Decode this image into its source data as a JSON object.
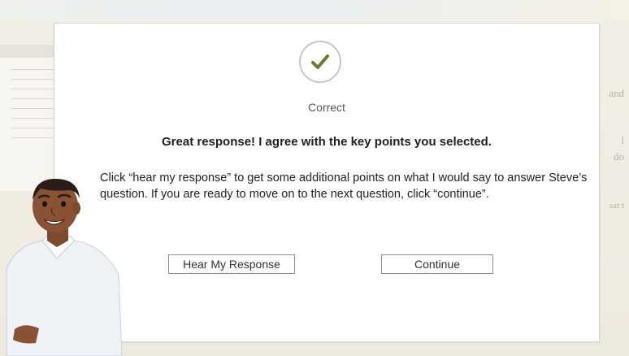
{
  "background": {
    "side_text": [
      "and",
      "l",
      "do",
      "sat t"
    ]
  },
  "modal": {
    "status_icon": "check-icon",
    "status_label": "Correct",
    "headline": "Great response! I agree with the key points you selected.",
    "body": "Click “hear my response” to get some additional points on what I would say to answer Steve’s question. If you are ready to move on to the next question, click “continue”.",
    "buttons": {
      "hear_label": "Hear My Response",
      "continue_label": "Continue"
    }
  },
  "colors": {
    "check": "#6b7a2e",
    "modal_bg": "#ffffff",
    "shirt": "#eef2f6",
    "skin": "#8a5234",
    "hair": "#2a1c16"
  }
}
